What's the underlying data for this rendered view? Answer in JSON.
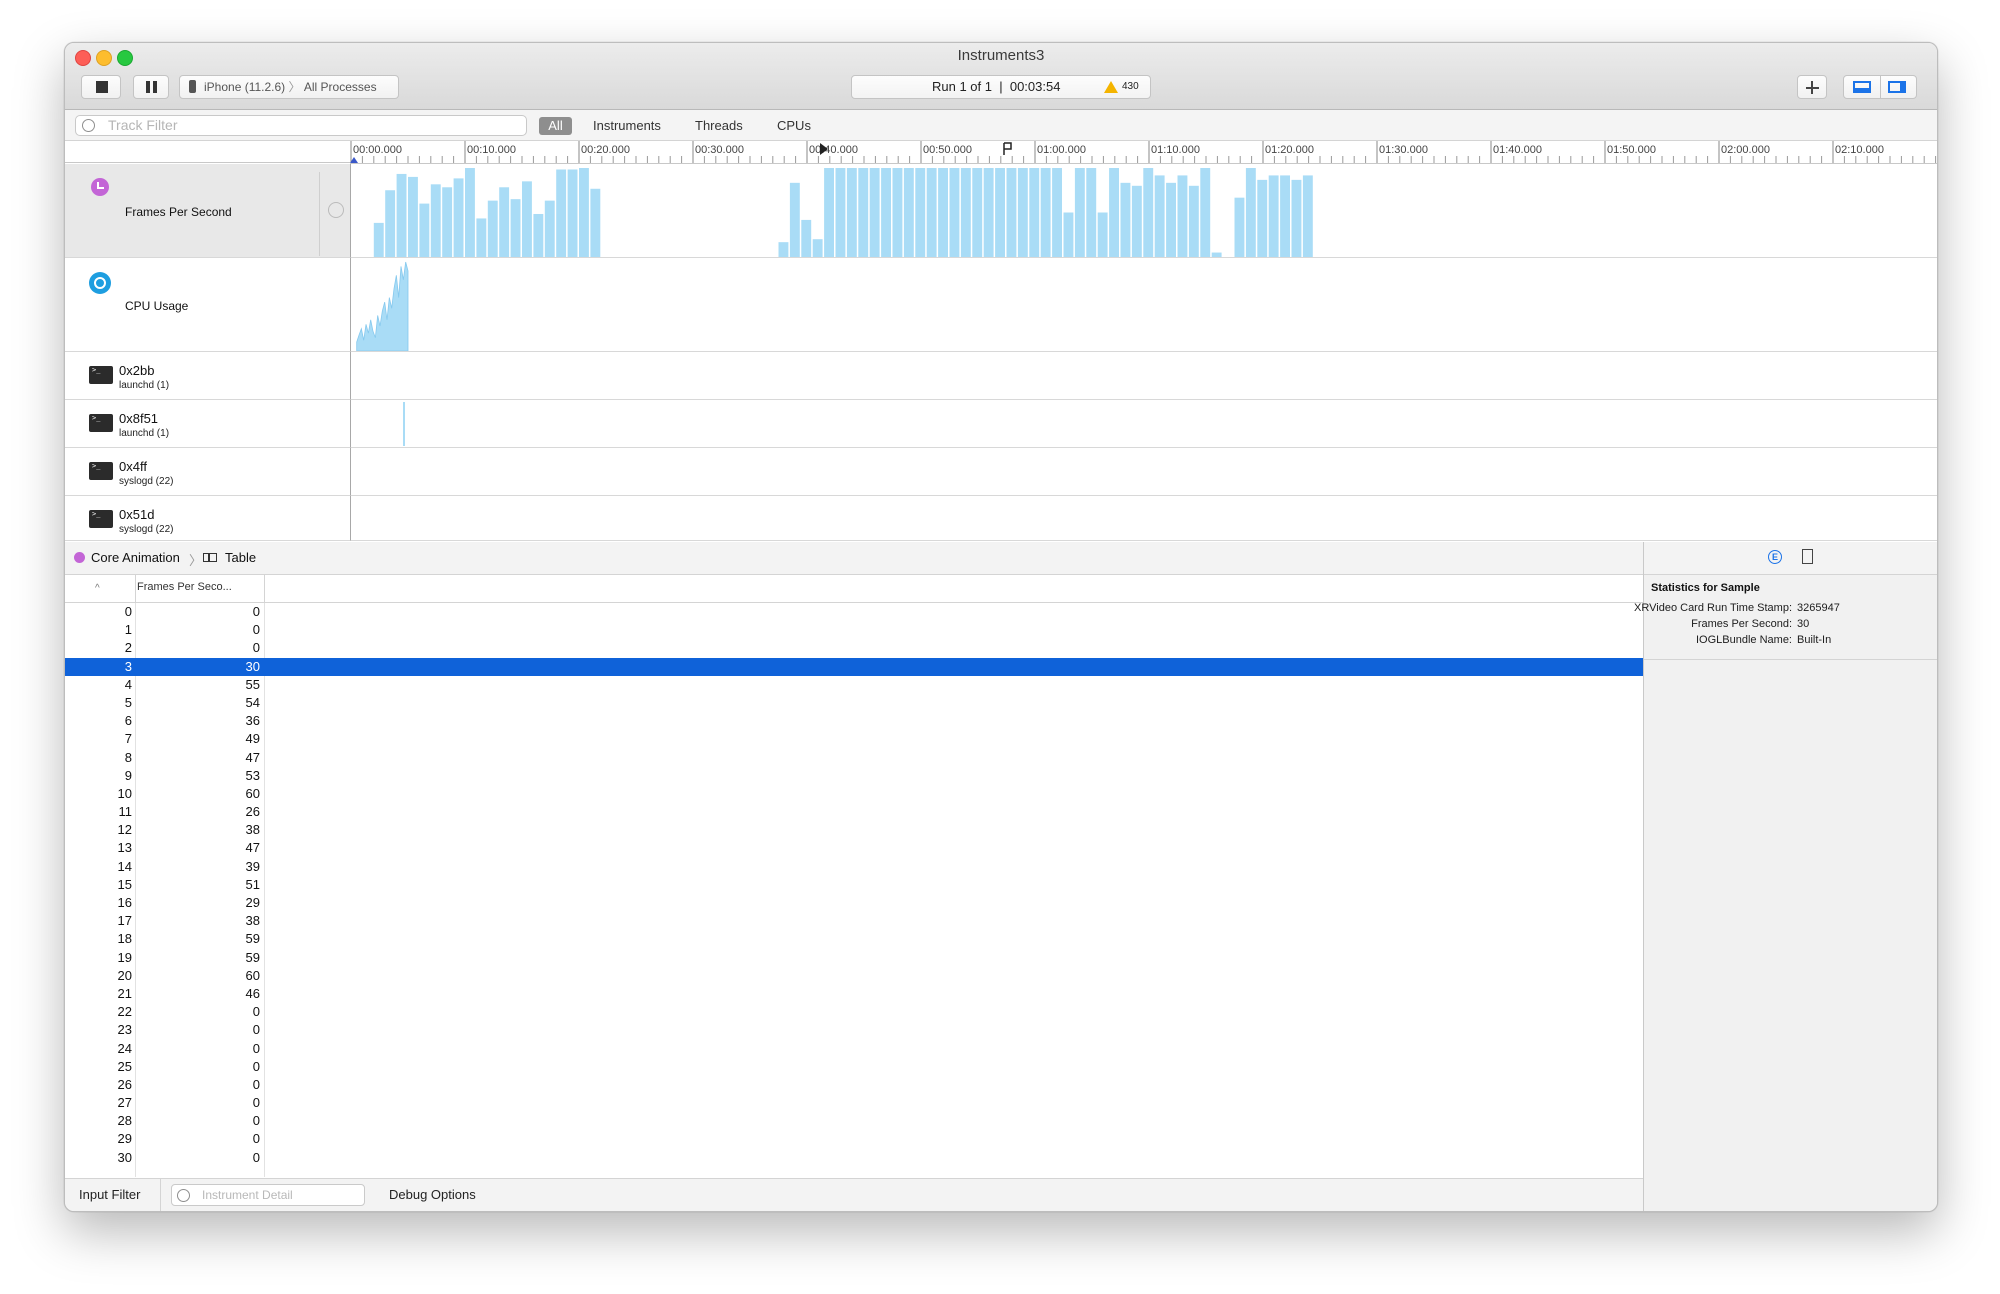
{
  "window": {
    "title": "Instruments3"
  },
  "toolbar": {
    "target_device": "iPhone (11.2.6)",
    "target_process": "All Processes",
    "run_label": "Run 1 of 1",
    "run_time": "00:03:54",
    "warning_count": "430"
  },
  "filterbar": {
    "search_placeholder": "Track Filter",
    "segments": [
      "All",
      "Instruments",
      "Threads",
      "CPUs"
    ]
  },
  "ruler": {
    "ticks": [
      "00:00.000",
      "00:10.000",
      "00:20.000",
      "00:30.000",
      "00:40.000",
      "00:50.000",
      "01:00.000",
      "01:10.000",
      "01:20.000",
      "01:30.000",
      "01:40.000",
      "01:50.000",
      "02:00.000",
      "02:10.000"
    ]
  },
  "tracks": [
    {
      "label": "Frames Per Second",
      "icon": "fps-instrument-icon"
    },
    {
      "label": "CPU Usage",
      "icon": "cpu-usage-icon"
    }
  ],
  "threads": [
    {
      "name": "0x2bb",
      "process": "launchd (1)"
    },
    {
      "name": "0x8f51",
      "process": "launchd (1)"
    },
    {
      "name": "0x4ff",
      "process": "syslogd (22)"
    },
    {
      "name": "0x51d",
      "process": "syslogd (22)"
    }
  ],
  "fps_graph": {
    "segments": [
      {
        "start": 2.0,
        "values": [
          23,
          45,
          56,
          54,
          36,
          49,
          47,
          53,
          60,
          26,
          38,
          47,
          39,
          51,
          29,
          38,
          59,
          59,
          60,
          46
        ]
      },
      {
        "start": 37.5,
        "values": [
          10,
          50,
          25,
          12,
          60,
          60,
          60,
          60,
          60,
          60,
          60,
          60,
          60,
          60,
          60,
          60,
          60,
          60,
          60,
          60,
          60,
          60,
          60,
          60,
          60,
          30,
          60,
          60,
          30,
          60,
          50,
          48,
          60,
          55,
          50,
          55,
          48,
          60,
          3
        ]
      },
      {
        "start": 77.5,
        "values": [
          40,
          60,
          52,
          55,
          55,
          52,
          55
        ]
      }
    ],
    "max": 60
  },
  "cpu_graph": {
    "start": 0.5,
    "end": 5.0,
    "values": [
      10,
      18,
      25,
      12,
      30,
      20,
      35,
      22,
      15,
      40,
      28,
      45,
      55,
      35,
      60,
      48,
      70,
      85,
      60,
      95,
      80,
      100,
      90
    ]
  },
  "jumpbar": {
    "instrument": "Core Animation",
    "view": "Table"
  },
  "table": {
    "col_fps": "Frames Per Seco...",
    "selected_index": 3,
    "rows": [
      [
        "0",
        "0"
      ],
      [
        "1",
        "0"
      ],
      [
        "2",
        "0"
      ],
      [
        "3",
        "30"
      ],
      [
        "4",
        "55"
      ],
      [
        "5",
        "54"
      ],
      [
        "6",
        "36"
      ],
      [
        "7",
        "49"
      ],
      [
        "8",
        "47"
      ],
      [
        "9",
        "53"
      ],
      [
        "10",
        "60"
      ],
      [
        "11",
        "26"
      ],
      [
        "12",
        "38"
      ],
      [
        "13",
        "47"
      ],
      [
        "14",
        "39"
      ],
      [
        "15",
        "51"
      ],
      [
        "16",
        "29"
      ],
      [
        "17",
        "38"
      ],
      [
        "18",
        "59"
      ],
      [
        "19",
        "59"
      ],
      [
        "20",
        "60"
      ],
      [
        "21",
        "46"
      ],
      [
        "22",
        "0"
      ],
      [
        "23",
        "0"
      ],
      [
        "24",
        "0"
      ],
      [
        "25",
        "0"
      ],
      [
        "26",
        "0"
      ],
      [
        "27",
        "0"
      ],
      [
        "28",
        "0"
      ],
      [
        "29",
        "0"
      ],
      [
        "30",
        "0"
      ]
    ]
  },
  "bottombar": {
    "input_filter": "Input Filter",
    "detail_placeholder": "Instrument Detail",
    "debug_options": "Debug Options"
  },
  "inspector": {
    "title": "Statistics for Sample",
    "stats": [
      {
        "key": "XRVideo Card Run Time Stamp:",
        "value": "3265947"
      },
      {
        "key": "Frames Per Second:",
        "value": "30"
      },
      {
        "key": "IOGLBundle Name:",
        "value": "Built-In"
      }
    ]
  },
  "colors": {
    "accent": "#0f62d9",
    "graph": "#a9dcf6"
  }
}
